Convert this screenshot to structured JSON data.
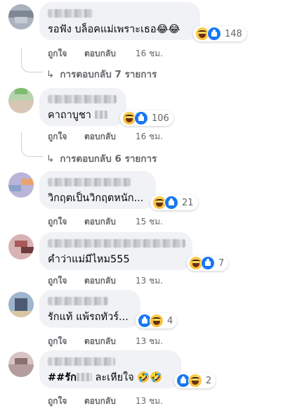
{
  "comments": [
    {
      "text": "รอฟัง บล็อคแม่เพราะเธอ😂😂",
      "reaction_count": "148",
      "reactions": [
        "haha",
        "like"
      ],
      "like_label": "ถูกใจ",
      "reply_label": "ตอบกลับ",
      "time": "16 ชม.",
      "replies_label": "การตอบกลับ 7 รายการ"
    },
    {
      "text": "คาถาบูชา",
      "reaction_count": "106",
      "reactions": [
        "haha",
        "like"
      ],
      "like_label": "ถูกใจ",
      "reply_label": "ตอบกลับ",
      "time": "16 ชม.",
      "replies_label": "การตอบกลับ 6 รายการ"
    },
    {
      "text": "วิกฤตเป็นวิกฤตหนัก...",
      "reaction_count": "21",
      "reactions": [
        "haha",
        "like"
      ],
      "like_label": "ถูกใจ",
      "reply_label": "ตอบกลับ",
      "time": "15 ชม."
    },
    {
      "text": "คำว่าแม่มีไหม555",
      "reaction_count": "7",
      "reactions": [
        "haha",
        "like"
      ],
      "like_label": "ถูกใจ",
      "reply_label": "ตอบกลับ",
      "time": "13 ชม."
    },
    {
      "text": "รักแท้ แพ้รถทัวร์...",
      "reaction_count": "4",
      "reactions": [
        "like",
        "haha"
      ],
      "like_label": "ถูกใจ",
      "reply_label": "ตอบกลับ",
      "time": "13 ชม."
    },
    {
      "text_prefix": "##รัก",
      "text_suffix": " ละเหียใจ 🤣🤣",
      "reaction_count": "2",
      "reactions": [
        "like",
        "haha"
      ],
      "like_label": "ถูกใจ",
      "reply_label": "ตอบกลับ",
      "time": "13 ชม."
    }
  ],
  "colors": {
    "bubble": "#f0f2f5",
    "secondary_text": "#65676b",
    "like_blue": "#1877f2",
    "haha_yellow": "#f7b125"
  }
}
